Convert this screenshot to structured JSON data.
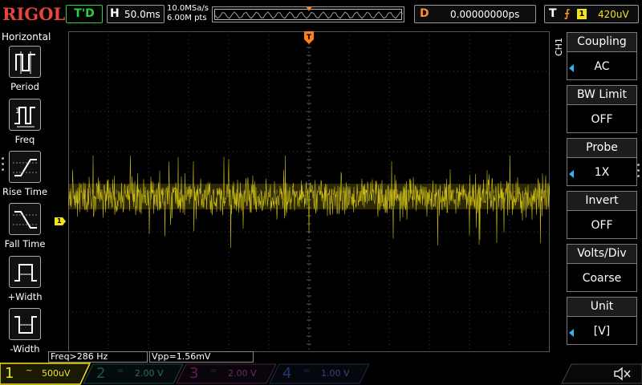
{
  "header": {
    "brand": "RIGOL",
    "run_status": "T'D",
    "timebase_letter": "H",
    "timebase_value": "50.0ms",
    "sample_rate": "10.0MSa/s",
    "memory_depth": "6.00M pts",
    "trigger_offset_letter": "D",
    "trigger_offset_value": "0.00000000ps",
    "trigger_letter": "T",
    "trigger_edge_icon": "rising-edge-icon",
    "trigger_source": "1",
    "trigger_level": "420uV"
  },
  "left_menu": {
    "title": "Horizontal",
    "items": [
      {
        "label": "Period",
        "icon": "period-icon"
      },
      {
        "label": "Freq",
        "icon": "frequency-icon"
      },
      {
        "label": "Rise Time",
        "icon": "rise-time-icon"
      },
      {
        "label": "Fall Time",
        "icon": "fall-time-icon"
      },
      {
        "label": "+Width",
        "icon": "positive-width-icon"
      },
      {
        "label": "-Width",
        "icon": "negative-width-icon"
      }
    ]
  },
  "right_menu": {
    "channel_label": "CH1",
    "items": [
      {
        "title": "Coupling",
        "value": "AC",
        "has_arrow": true
      },
      {
        "title": "BW Limit",
        "value": "OFF",
        "has_arrow": false
      },
      {
        "title": "Probe",
        "value": "1X",
        "has_arrow": true
      },
      {
        "title": "Invert",
        "value": "OFF",
        "has_arrow": false
      },
      {
        "title": "Volts/Div",
        "value": "Coarse",
        "has_arrow": false
      },
      {
        "title": "Unit",
        "value": "[V]",
        "has_arrow": true
      }
    ]
  },
  "markers": {
    "channel1": "1"
  },
  "measurements": {
    "freq": "Freq>286 Hz",
    "vpp": "Vpp=1.56mV"
  },
  "channels": [
    {
      "number": "1",
      "coupling": "~",
      "scale": "500uV",
      "color": "#f5e218",
      "active": true
    },
    {
      "number": "2",
      "coupling": "=",
      "scale": "2.00 V",
      "color": "#1fd4d4",
      "active": false
    },
    {
      "number": "3",
      "coupling": "=",
      "scale": "2.00 V",
      "color": "#e03cdb",
      "active": false
    },
    {
      "number": "4",
      "coupling": "=",
      "scale": "1.00 V",
      "color": "#2c7dff",
      "active": false
    }
  ],
  "colors": {
    "brand": "#e8453c",
    "run_status": "#29d13a",
    "trigger": "#ff7f1d",
    "channel1": "#f5e218",
    "menu_arrow": "#2fb7ee"
  }
}
